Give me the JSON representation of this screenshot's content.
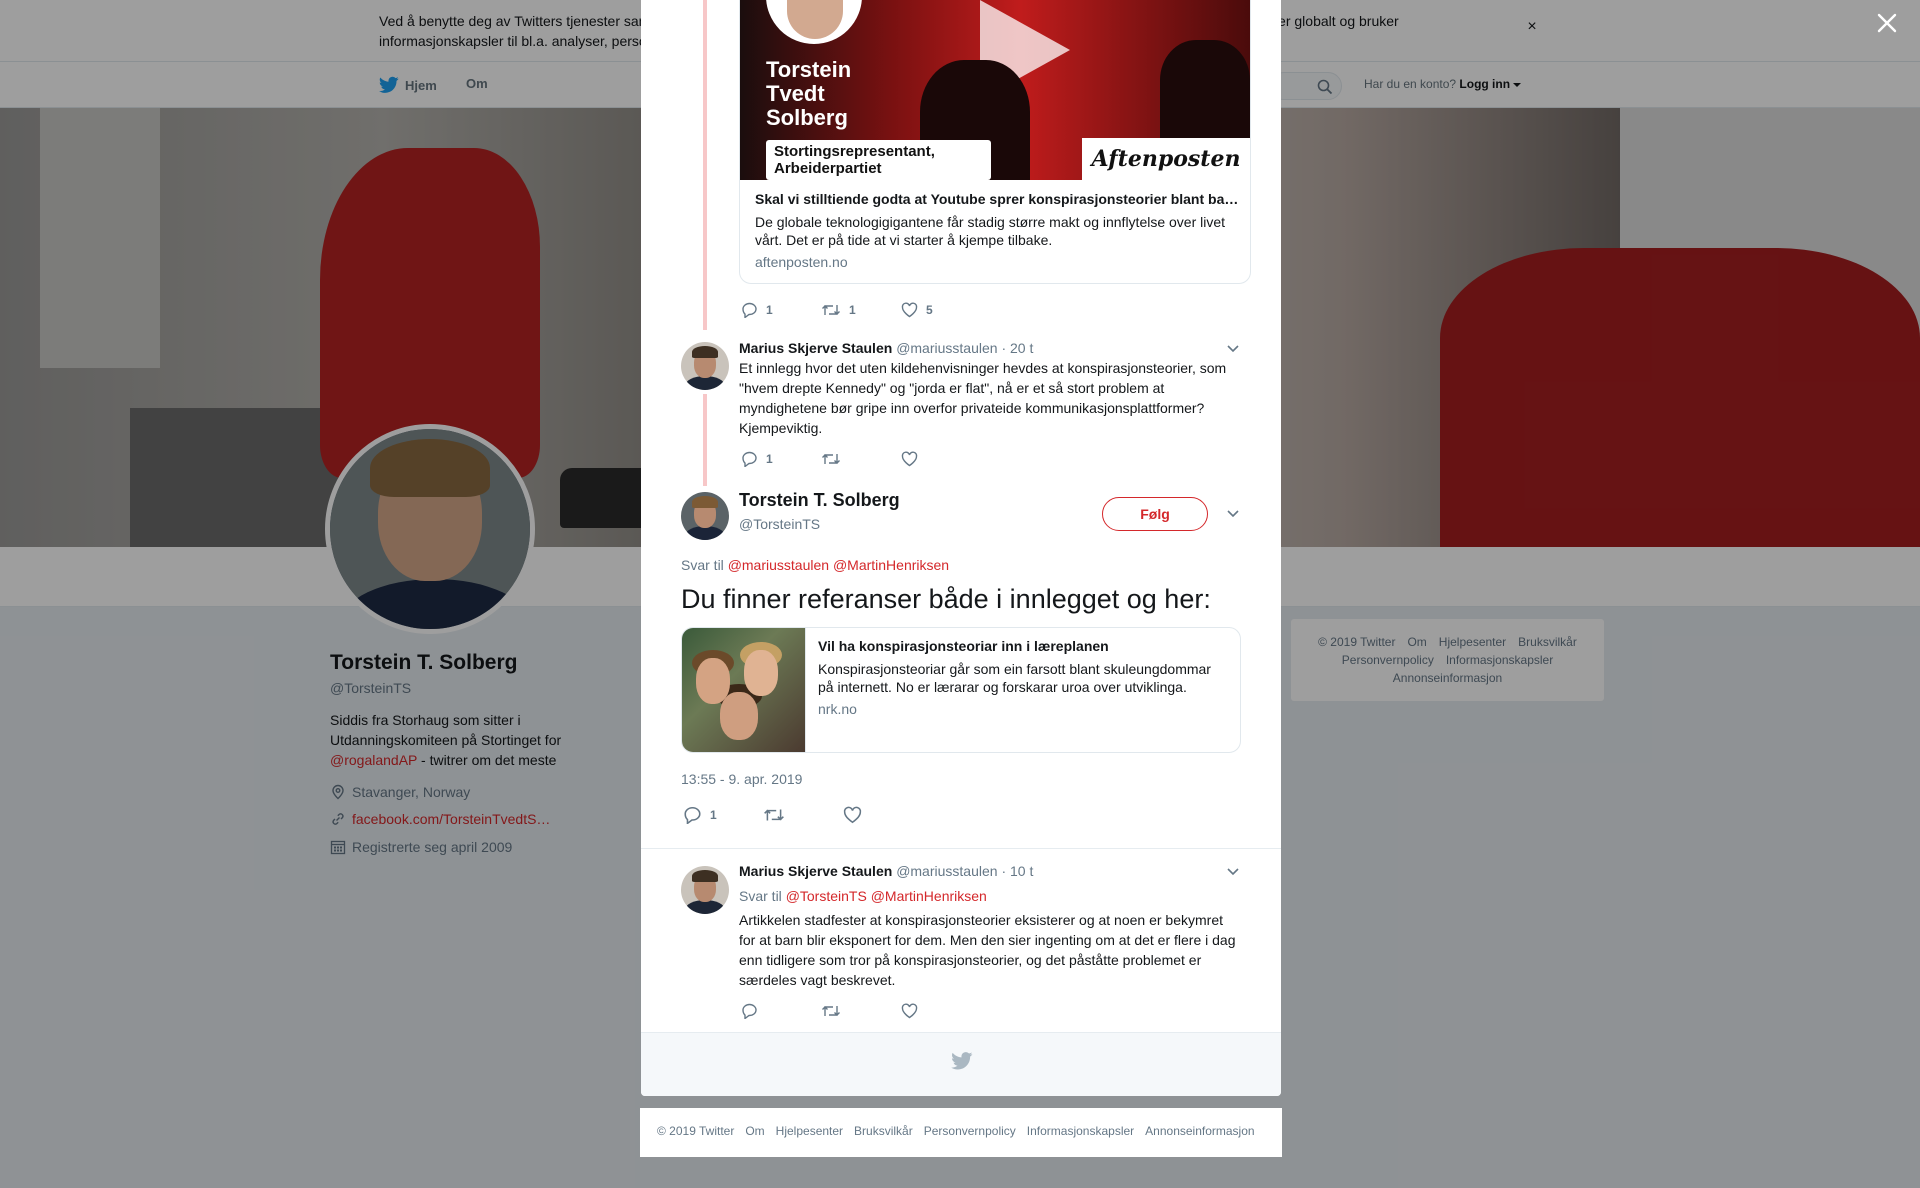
{
  "cookie": {
    "text": "Ved å benytte deg av Twitters tjenester samtykker du til vår bruk av informasjonskapsler og dataoverføring utenfor EU. Vi og våre partnere opererer globalt og bruker informasjonskapsler til bl.a. analyser, personalisering og annonser.",
    "close": "×"
  },
  "nav": {
    "home": "Hjem",
    "about": "Om",
    "account_prompt": "Har du en konto?",
    "login": "Logg inn"
  },
  "profile": {
    "name": "Torstein T. Solberg",
    "handle": "@TorsteinTS",
    "bio_prefix": "Siddis fra Storhaug som sitter i Utdanningskomiteen på Stortinget for",
    "bio_link": "@rogalandAP",
    "bio_suffix": " - twitrer om det meste",
    "location": "Stavanger, Norway",
    "website": "facebook.com/TorsteinTvedtS…",
    "joined": "Registrerte seg april 2009"
  },
  "side_footer": {
    "items": [
      "© 2019 Twitter",
      "Om",
      "Hjelpesenter",
      "Bruksvilkår",
      "Personvernpolicy",
      "Informasjonskapsler",
      "Annonseinformasjon"
    ]
  },
  "thread": {
    "card1": {
      "image_title": "Torstein Tvedt Solberg",
      "image_subtitle": "Stortingsrepresentant, Arbeiderpartiet",
      "image_brand": "Aftenposten",
      "title": "Skal vi stilltiende godta at Youtube sprer konspirasjonsteorier blant barn?",
      "description": "De globale teknologigigantene får stadig større makt og innflytelse over livet vårt. Det er på tide at vi starter å kjempe tilbake.",
      "domain": "aftenposten.no"
    },
    "tweet1_actions": {
      "replies": "1",
      "retweets": "1",
      "likes": "5"
    },
    "reply1": {
      "name": "Marius Skjerve Staulen",
      "handle": "@mariusstaulen",
      "time": "· 20 t",
      "text": "Et innlegg hvor det uten kildehenvisninger hevdes at konspirasjonsteorier, som \"hvem drepte Kennedy\" og \"jorda er flat\", nå er et så stort problem at myndighetene bør gripe inn overfor privateide kommunikasjonsplattformer? Kjempeviktig.",
      "replies": "1"
    },
    "main": {
      "name": "Torstein T. Solberg",
      "handle": "@TorsteinTS",
      "follow": "Følg",
      "reply_label": "Svar til",
      "reply_to_1": "@mariusstaulen",
      "reply_to_2": "@MartinHenriksen",
      "text": "Du finner referanser både i innlegget og her:",
      "card": {
        "title": "Vil ha konspirasjonsteoriar inn i læreplanen",
        "description": "Konspirasjonsteoriar går som ein farsott blant skuleungdommar på internett. No er lærarar og forskarar uroa over utviklinga.",
        "domain": "nrk.no"
      },
      "timestamp": "13:55 - 9. apr. 2019",
      "replies": "1"
    },
    "reply2": {
      "name": "Marius Skjerve Staulen",
      "handle": "@mariusstaulen",
      "time": "· 10 t",
      "reply_label": "Svar til",
      "reply_to_1": "@TorsteinTS",
      "reply_to_2": "@MartinHenriksen",
      "text": "Artikkelen stadfester at konspirasjonsteorier eksisterer og at noen er bekymret for at barn blir eksponert for dem. Men den sier ingenting om at det er flere i dag enn tidligere som tror på konspirasjonsteorier, og det påståtte problemet er særdeles vagt beskrevet."
    }
  },
  "bottom_footer": {
    "items": [
      "© 2019 Twitter",
      "Om",
      "Hjelpesenter",
      "Bruksvilkår",
      "Personvernpolicy",
      "Informasjonskapsler",
      "Annonseinformasjon"
    ]
  },
  "colors": {
    "accent": "#d4282b",
    "twitter_blue": "#1da1f2",
    "thread_line": "#f7c7c8"
  }
}
